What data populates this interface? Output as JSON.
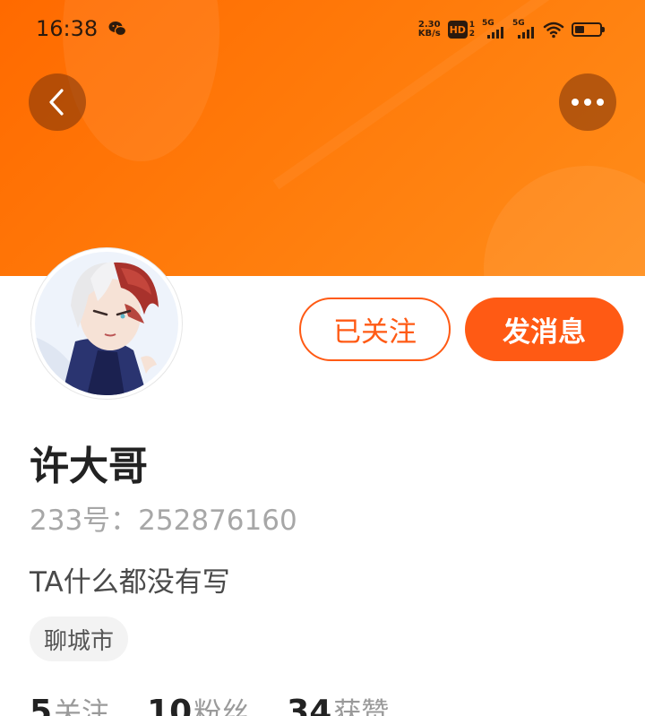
{
  "status_bar": {
    "time": "16:38",
    "net_speed_value": "2.30",
    "net_speed_unit": "KB/s",
    "hd_label": "HD",
    "hd_sub": "1\n2",
    "sim1_label": "5G",
    "sim2_label": "5G",
    "battery_level": 0.4
  },
  "header": {
    "accent_color": "#ff6a00",
    "back_icon": "chevron-left-icon",
    "more_icon": "more-dots-icon"
  },
  "actions": {
    "follow_label": "已关注",
    "message_label": "发消息",
    "accent_color": "#ff5a14"
  },
  "profile": {
    "name": "许大哥",
    "uid": "233号：252876160",
    "bio": "TA什么都没有写",
    "location": "聊城市"
  },
  "stats": [
    {
      "value": "5",
      "label": "关注"
    },
    {
      "value": "10",
      "label": "粉丝"
    },
    {
      "value": "34",
      "label": "获赞"
    }
  ]
}
